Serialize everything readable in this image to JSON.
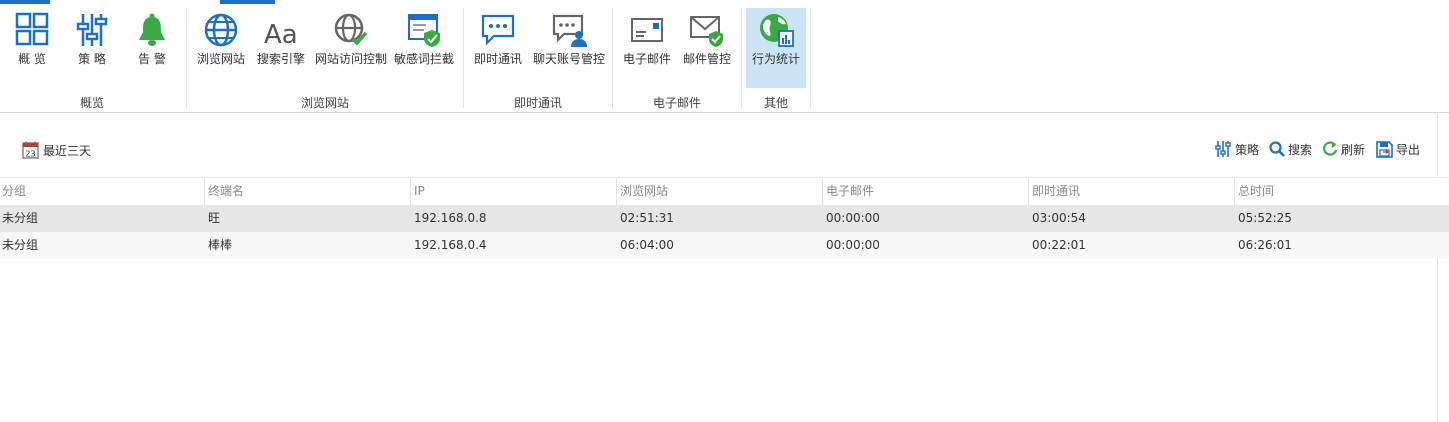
{
  "ribbon": {
    "buttons": [
      {
        "label": "概 览",
        "icon": "dashboard-grid-icon"
      },
      {
        "label": "策 略",
        "icon": "sliders-icon"
      },
      {
        "label": "告 警",
        "icon": "bell-icon"
      },
      {
        "label": "浏览网站",
        "icon": "globe-icon"
      },
      {
        "label": "搜索引擎",
        "icon": "font-aa-icon"
      },
      {
        "label": "网站访问控制",
        "icon": "globe-check-icon"
      },
      {
        "label": "敏感词拦截",
        "icon": "browser-shield-icon"
      },
      {
        "label": "即时通讯",
        "icon": "chat-bubble-icon"
      },
      {
        "label": "聊天账号管控",
        "icon": "chat-user-icon"
      },
      {
        "label": "电子邮件",
        "icon": "email-icon"
      },
      {
        "label": "邮件管控",
        "icon": "email-shield-icon"
      },
      {
        "label": "行为统计",
        "icon": "earth-stats-icon"
      }
    ],
    "groups": [
      "概览",
      "浏览网站",
      "即时通讯",
      "电子邮件",
      "其他"
    ],
    "active_button": "行为统计"
  },
  "toolbar": {
    "date_label": "最近三天",
    "calendar_day": "23",
    "policy_label": "策略",
    "search_label": "搜索",
    "refresh_label": "刷新",
    "export_label": "导出"
  },
  "table": {
    "columns": [
      "分组",
      "终端名",
      "IP",
      "浏览网站",
      "电子邮件",
      "即时通讯",
      "总时间"
    ],
    "rows": [
      [
        "未分组",
        "旺",
        "192.168.0.8",
        "02:51:31",
        "00:00:00",
        "03:00:54",
        "05:52:25"
      ],
      [
        "未分组",
        "棒棒",
        "192.168.0.4",
        "06:04:00",
        "00:00:00",
        "00:22:01",
        "06:26:01"
      ]
    ]
  },
  "colors": {
    "accent": "#1e6fc0",
    "active_bg": "#cce4f7",
    "icon_green": "#3aa845",
    "selected_row": "#e6e6e6"
  }
}
